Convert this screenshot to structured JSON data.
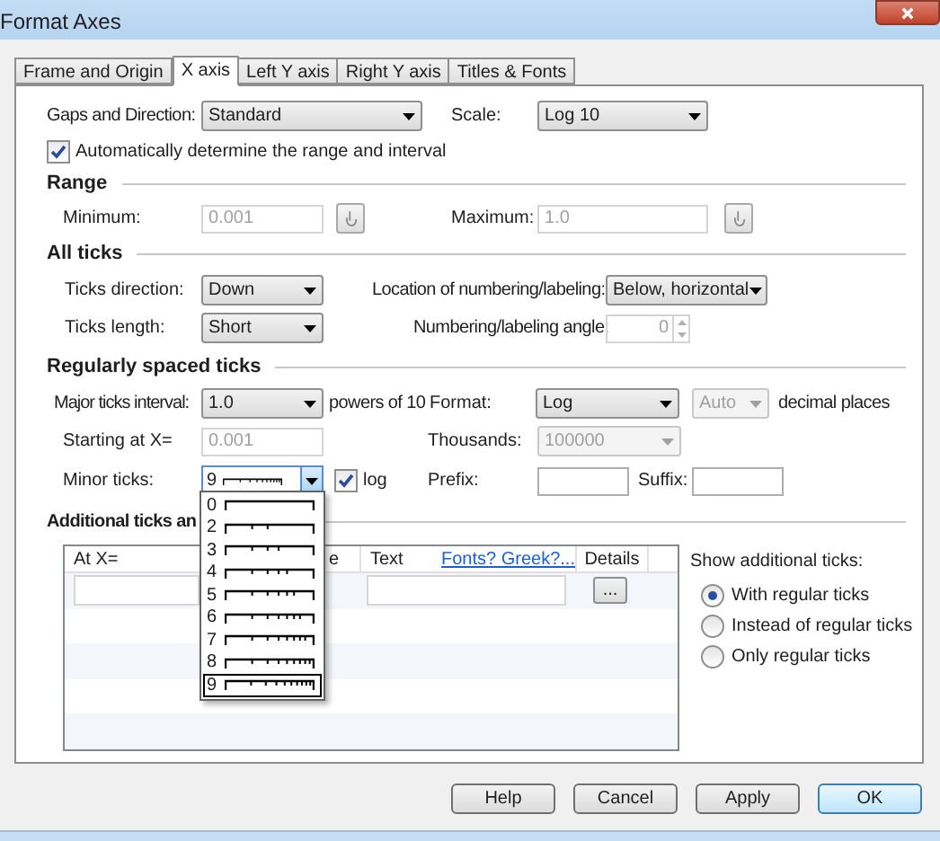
{
  "window": {
    "title": "Format Axes"
  },
  "tabs": [
    {
      "label": "Frame and Origin",
      "selected": false
    },
    {
      "label": "X axis",
      "selected": true
    },
    {
      "label": "Left Y axis",
      "selected": false
    },
    {
      "label": "Right Y axis",
      "selected": false
    },
    {
      "label": "Titles & Fonts",
      "selected": false
    }
  ],
  "gaps_and_direction": {
    "label": "Gaps and Direction:",
    "value": "Standard"
  },
  "scale": {
    "label": "Scale:",
    "value": "Log 10"
  },
  "auto_range": {
    "label": "Automatically determine the range and interval",
    "checked": true
  },
  "range": {
    "heading": "Range",
    "minimum": {
      "label": "Minimum:",
      "value": "0.001",
      "disabled": true
    },
    "maximum": {
      "label": "Maximum:",
      "value": "1.0",
      "disabled": true
    }
  },
  "all_ticks": {
    "heading": "All ticks",
    "ticks_direction": {
      "label": "Ticks direction:",
      "value": "Down"
    },
    "location": {
      "label": "Location of numbering/labeling:",
      "value": "Below, horizontal"
    },
    "ticks_length": {
      "label": "Ticks length:",
      "value": "Short"
    },
    "angle": {
      "label": "Numbering/labeling angle:",
      "value": "0",
      "disabled": true
    }
  },
  "regular_ticks": {
    "heading": "Regularly spaced ticks",
    "major_interval": {
      "label": "Major ticks interval:",
      "value": "1.0",
      "suffix": "powers of 10"
    },
    "format": {
      "label": "Format:",
      "value": "Log"
    },
    "decimal_places": {
      "value": "Auto",
      "disabled": true,
      "suffix": "decimal places"
    },
    "starting_at": {
      "label": "Starting at X=",
      "value": "0.001",
      "disabled": true
    },
    "thousands": {
      "label": "Thousands:",
      "value": "100000",
      "disabled": true
    },
    "minor_ticks": {
      "label": "Minor ticks:",
      "value": "9",
      "expanded": true,
      "options": [
        {
          "label": "0",
          "selected": false
        },
        {
          "label": "2",
          "selected": false
        },
        {
          "label": "3",
          "selected": false
        },
        {
          "label": "4",
          "selected": false
        },
        {
          "label": "5",
          "selected": false
        },
        {
          "label": "6",
          "selected": false
        },
        {
          "label": "7",
          "selected": false
        },
        {
          "label": "8",
          "selected": false
        },
        {
          "label": "9",
          "selected": true
        }
      ]
    },
    "log": {
      "label": "log",
      "checked": true
    },
    "prefix": {
      "label": "Prefix:"
    },
    "suffix": {
      "label": "Suffix:"
    }
  },
  "additional_ticks": {
    "heading": "Additional ticks an",
    "columns": [
      "At X=",
      "e",
      "Text",
      "Fonts? Greek?...",
      "Details"
    ],
    "rows": [
      {
        "details": "..."
      }
    ],
    "show_label": "Show additional ticks:",
    "options": [
      {
        "label": "With regular ticks",
        "selected": true
      },
      {
        "label": "Instead of regular ticks",
        "selected": false
      },
      {
        "label": "Only regular ticks",
        "selected": false
      }
    ]
  },
  "buttons": [
    {
      "label": "Help",
      "default": false
    },
    {
      "label": "Cancel",
      "default": false
    },
    {
      "label": "Apply",
      "default": false
    },
    {
      "label": "OK",
      "default": true
    }
  ]
}
